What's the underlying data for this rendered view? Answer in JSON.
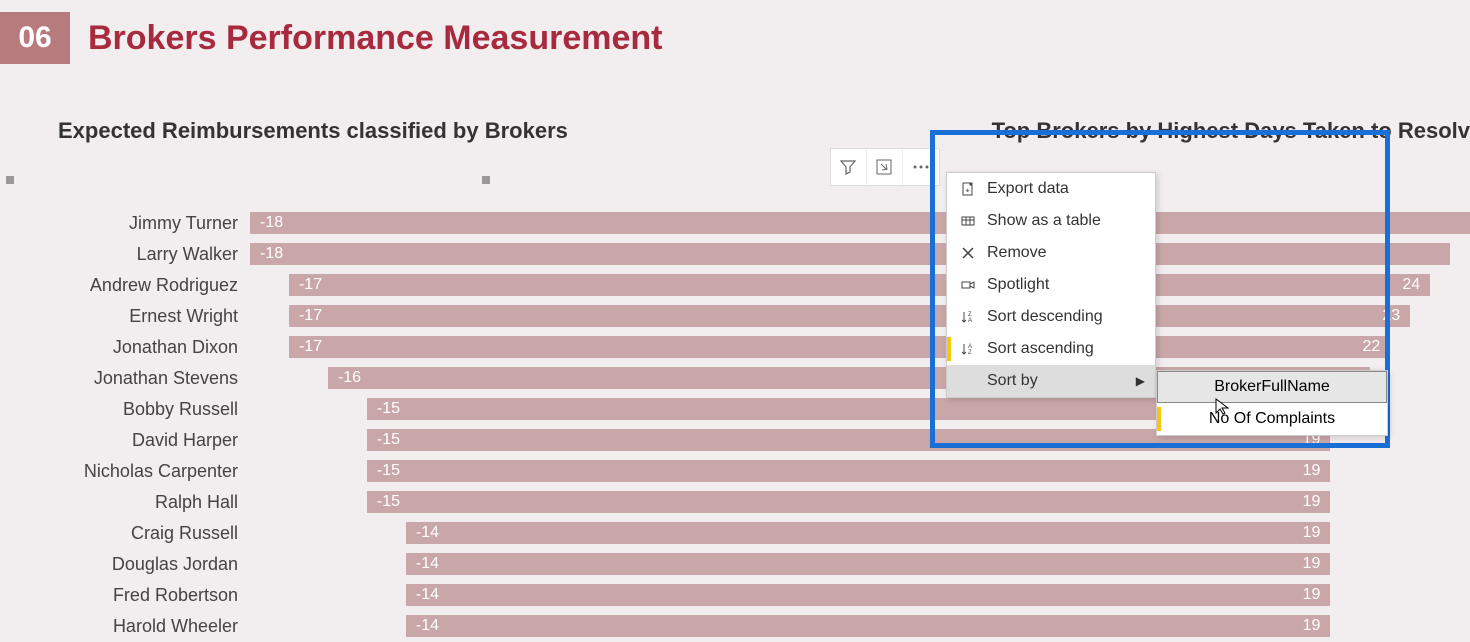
{
  "page_number": "06",
  "page_title": "Brokers Performance Measurement",
  "left_chart": {
    "title": "Expected Reimbursements classified by Brokers"
  },
  "right_chart": {
    "title": "Top Brokers by Highest Days Taken to Resolv"
  },
  "context_menu": {
    "export": "Export data",
    "show_table": "Show as a table",
    "remove": "Remove",
    "spotlight": "Spotlight",
    "sort_desc": "Sort descending",
    "sort_asc": "Sort ascending",
    "sort_by": "Sort by"
  },
  "submenu": {
    "broker_full_name": "BrokerFullName",
    "no_of_complaints": "No Of Complaints"
  },
  "chart_data": [
    {
      "type": "bar",
      "title": "Expected Reimbursements classified by Brokers",
      "orientation": "horizontal",
      "categories": [
        "Jimmy Turner",
        "Larry Walker",
        "Andrew Rodriguez",
        "Ernest Wright",
        "Jonathan Dixon",
        "Jonathan Stevens",
        "Bobby Russell",
        "David Harper",
        "Nicholas Carpenter",
        "Ralph Hall",
        "Craig Russell",
        "Douglas Jordan",
        "Fred Robertson",
        "Harold Wheeler"
      ],
      "values": [
        -18,
        -18,
        -17,
        -17,
        -17,
        -16,
        -15,
        -15,
        -15,
        -15,
        -14,
        -14,
        -14,
        -14
      ],
      "xlim": [
        -18,
        0
      ]
    },
    {
      "type": "bar",
      "title": "Top Brokers by Highest Days Taken to Resolve",
      "orientation": "horizontal",
      "values_visible": [
        "",
        "",
        "24",
        "23",
        "22",
        "",
        "",
        "19",
        "19",
        "19",
        "19",
        "19",
        "19",
        "19"
      ],
      "values": [
        26,
        25,
        24,
        23,
        22,
        21,
        20,
        19,
        19,
        19,
        19,
        19,
        19,
        19
      ],
      "xlim": [
        0,
        26
      ]
    }
  ]
}
